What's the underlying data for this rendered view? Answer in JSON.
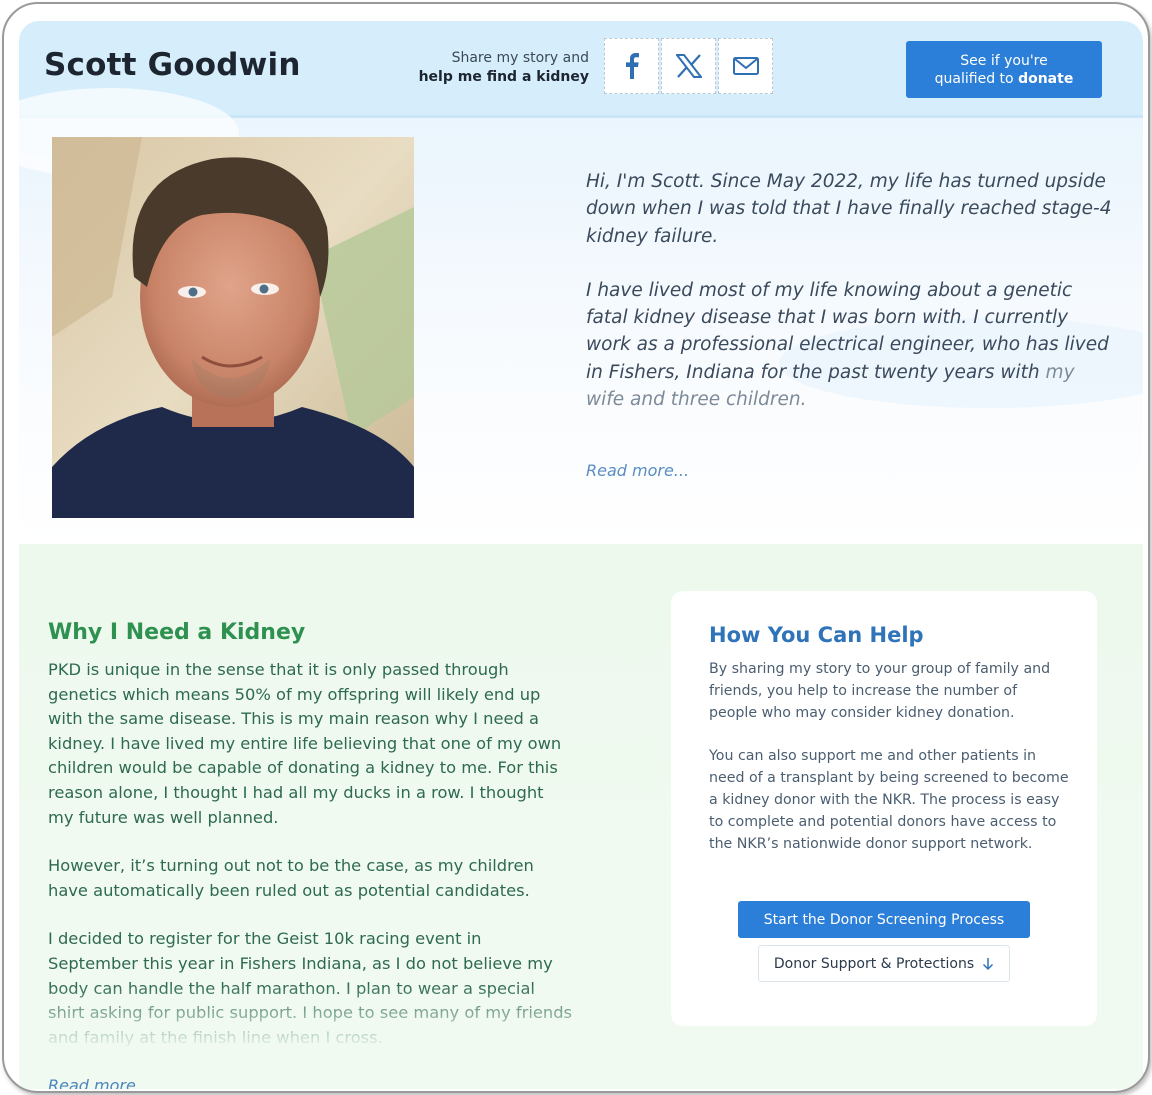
{
  "header": {
    "name": "Scott Goodwin",
    "share_line1": "Share my story and",
    "share_line2": "help me find a kidney",
    "share_buttons": [
      {
        "icon": "facebook-icon"
      },
      {
        "icon": "x-icon"
      },
      {
        "icon": "mail-icon"
      }
    ],
    "donate_line1": "See if you're",
    "donate_line2_prefix": "qualified to ",
    "donate_line2_bold": "donate"
  },
  "hero": {
    "photo_alt": "Portrait photo",
    "intro_paragraphs": [
      "Hi, I'm Scott. Since May 2022, my life has turned upside down when I was told that I have finally reached stage-4 kidney failure.",
      "I have lived most of my life knowing about a genetic fatal kidney disease that I was born with. I currently work as a professional electrical engineer, who has lived in Fishers, Indiana for the past twenty years with"
    ],
    "intro_fade_text": "my wife and three children.",
    "read_more": "Read more..."
  },
  "why": {
    "title": "Why I Need a Kidney",
    "paragraphs": [
      "PKD is unique in the sense that it is only passed through genetics which means 50% of my offspring will likely end up with the same disease. This is my main reason why I need a kidney. I have lived my entire life believing that one of my own children would be capable of donating a kidney to me. For this reason alone, I thought I had all my ducks in a row. I thought my future was well planned.",
      "However, it’s turning out not to be the case, as my children have automatically been ruled out as potential candidates.",
      "I decided to register for the Geist 10k racing event in September this year in Fishers Indiana, as I do not believe my body can handle the half marathon. I plan to wear a special shirt asking for public support. I hope to see many of my friends and family at the finish line when I cross."
    ],
    "read_more": "Read more..."
  },
  "help": {
    "title": "How You Can Help",
    "paragraphs": [
      "By sharing my story to your group of family and friends, you help to increase the number of people who may consider kidney donation.",
      "You can also support me and other patients in need of a transplant by being screened to become a kidney donor with the NKR. The process is easy to complete and potential donors have access to the NKR’s nationwide donor support network."
    ],
    "screening_button": "Start the Donor Screening Process",
    "support_button": "Donor Support & Protections"
  },
  "colors": {
    "header_bg": "#d6eefb",
    "accent_blue": "#2b7fd9",
    "green_title": "#2e9150",
    "lower_bg": "#eef9ee"
  }
}
